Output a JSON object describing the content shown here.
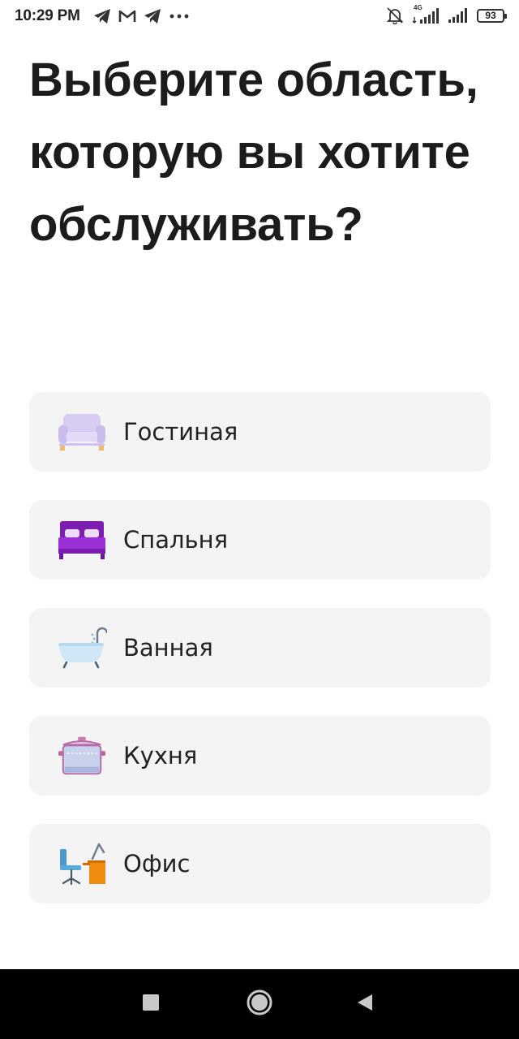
{
  "status_bar": {
    "time": "10:29 PM",
    "network_type": "4G",
    "battery_level": "93",
    "left_icons": [
      "telegram-icon",
      "mail-icon",
      "telegram-icon",
      "more-dots-icon"
    ],
    "right_icons": [
      "bell-muted-icon",
      "signal-4g-icon",
      "signal-icon",
      "battery-icon"
    ]
  },
  "page": {
    "title": "Выберите область, которую вы хотите обслуживать?"
  },
  "options": [
    {
      "label": "Гостиная",
      "icon": "sofa-icon"
    },
    {
      "label": "Спальня",
      "icon": "bed-icon"
    },
    {
      "label": "Ванная",
      "icon": "bathtub-icon"
    },
    {
      "label": "Кухня",
      "icon": "cooking-pot-icon"
    },
    {
      "label": "Офис",
      "icon": "office-desk-icon"
    }
  ],
  "nav_bar": {
    "buttons": [
      "recent-apps-icon",
      "home-icon",
      "back-icon"
    ]
  },
  "colors": {
    "card_background": "#f4f4f4",
    "title_text": "#1c1c1c",
    "nav_background": "#000000",
    "sofa": "#d3c6f0",
    "bed": "#8e24c7",
    "bathtub": "#cfe7f7",
    "desk": "#f08c10"
  }
}
